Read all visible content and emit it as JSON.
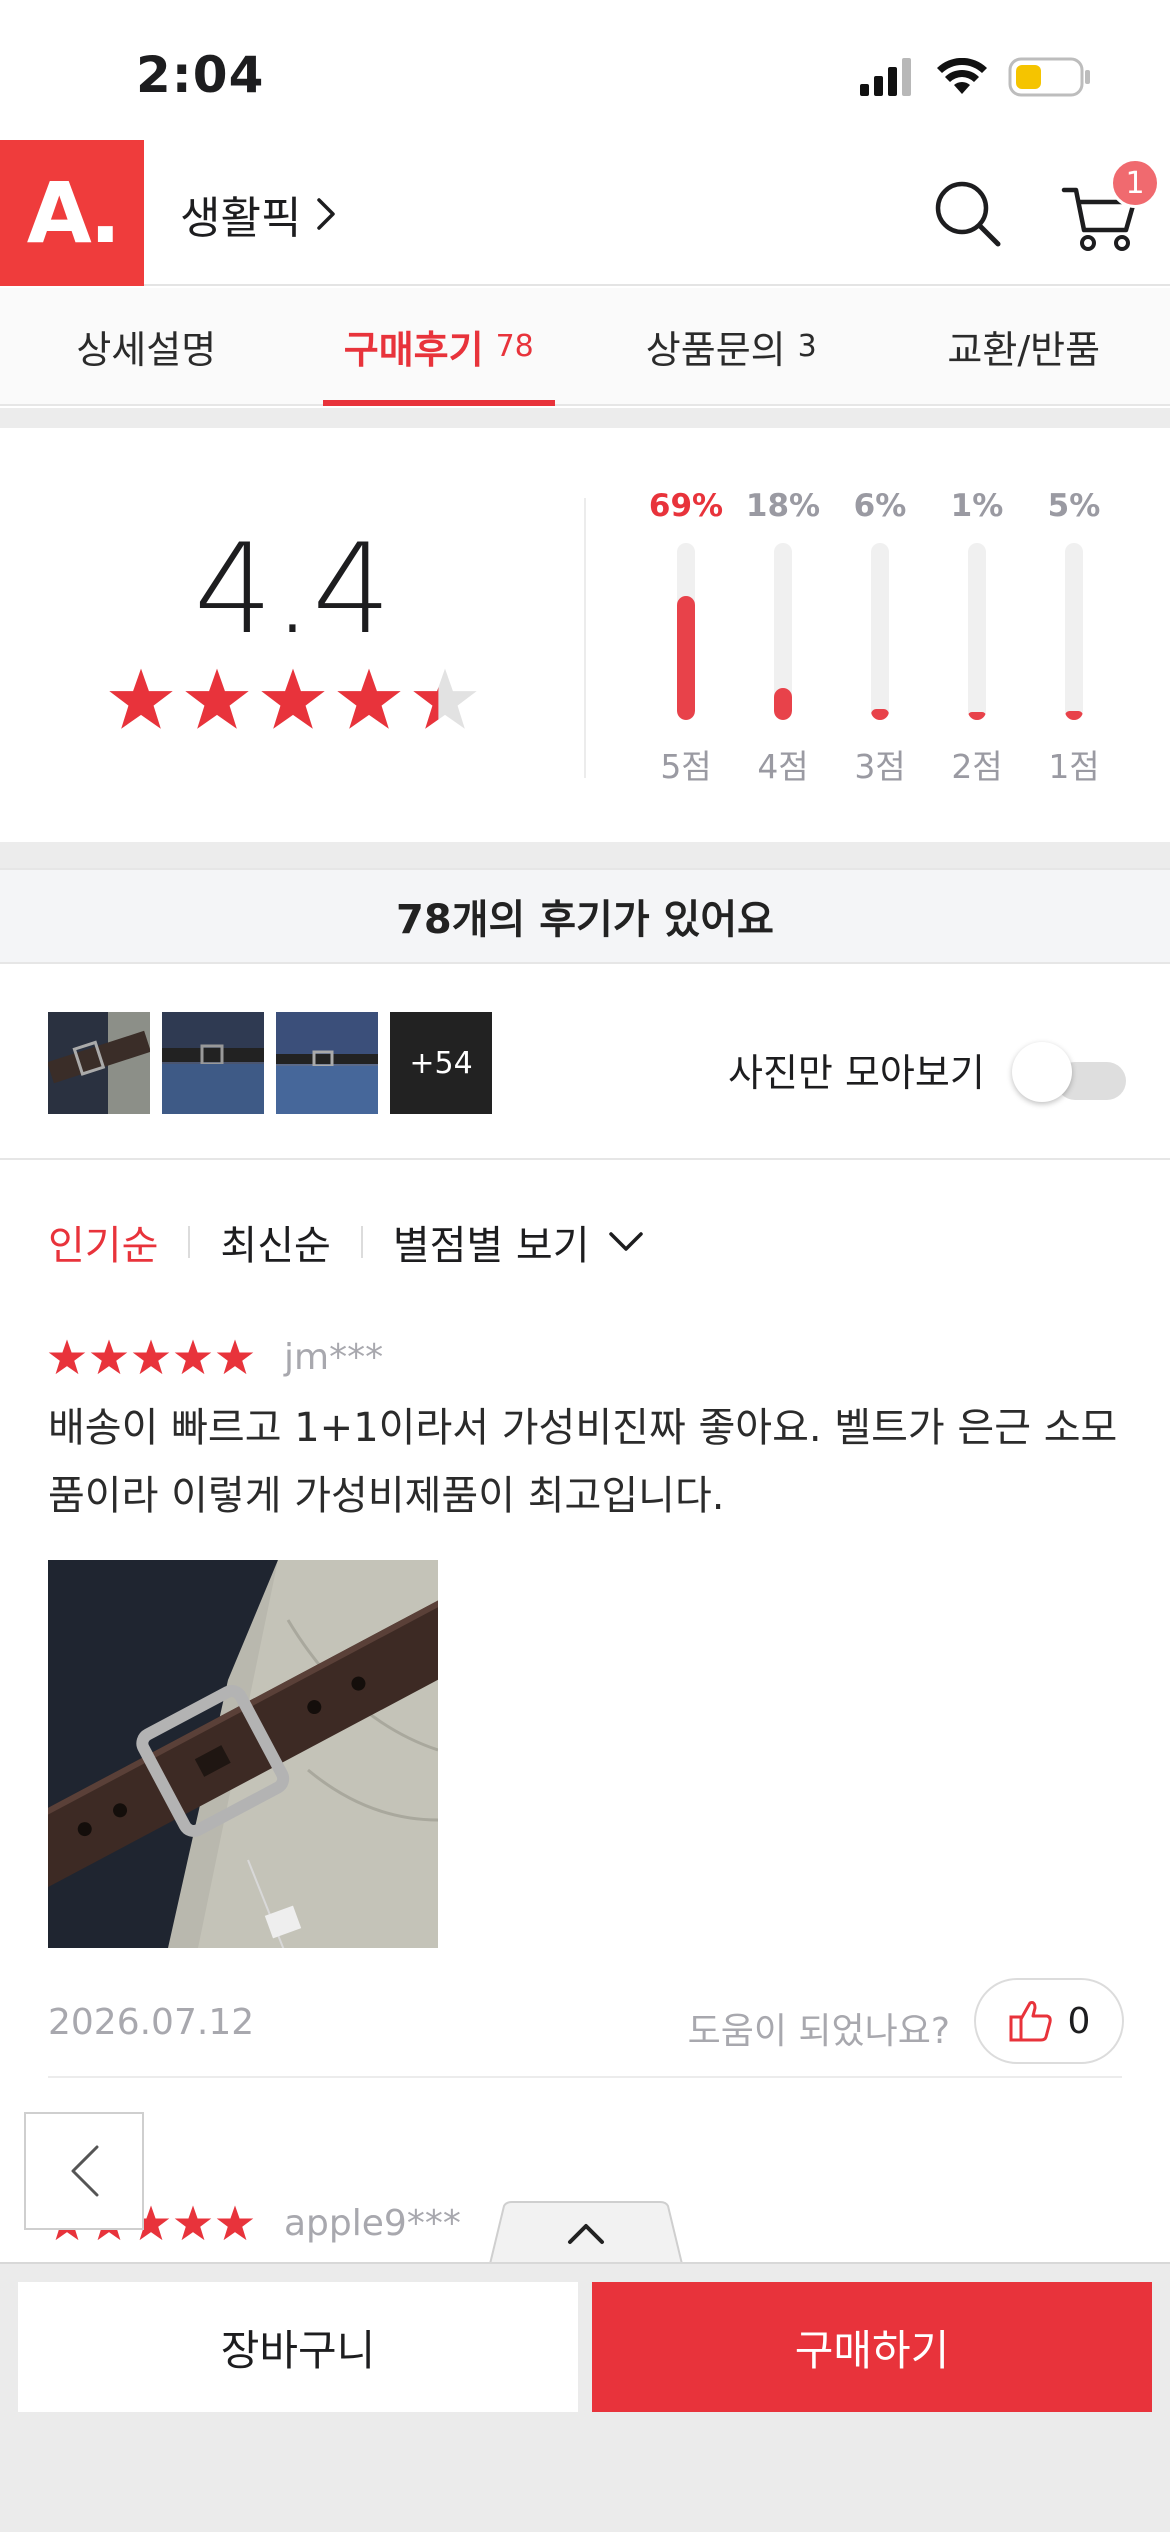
{
  "status_bar": {
    "time": "2:04"
  },
  "header": {
    "logo": "A.",
    "category": "생활픽",
    "cart_count": "1"
  },
  "tabs": [
    {
      "label": "상세설명",
      "count": ""
    },
    {
      "label": "구매후기",
      "count": "78",
      "active": true
    },
    {
      "label": "상품문의",
      "count": "3"
    },
    {
      "label": "교환/반품",
      "count": ""
    }
  ],
  "rating_summary": {
    "average": "4.4",
    "stars_value": 4.4,
    "distribution": [
      {
        "label": "5점",
        "percent_text": "69%",
        "value": 69
      },
      {
        "label": "4점",
        "percent_text": "18%",
        "value": 18
      },
      {
        "label": "3점",
        "percent_text": "6%",
        "value": 6
      },
      {
        "label": "2점",
        "percent_text": "1%",
        "value": 1
      },
      {
        "label": "1점",
        "percent_text": "5%",
        "value": 5
      }
    ]
  },
  "review_count_text": "78개의 후기가 있어요",
  "photos": {
    "more_label": "+54",
    "toggle_label": "사진만 모아보기",
    "toggle_on": false
  },
  "sort": {
    "popular": "인기순",
    "latest": "최신순",
    "by_rating": "별점별 보기"
  },
  "reviews": [
    {
      "rating": 5,
      "reviewer": "jm***",
      "text": "배송이 빠르고 1+1이라서 가성비진짜 좋아요. 벨트가 은근 소모품이라 이렇게 가성비제품이 최고입니다.",
      "date": "2026.07.12",
      "helpful_question": "도움이 되었나요?",
      "helpful_count": "0"
    },
    {
      "rating": 5,
      "reviewer": "apple9***"
    }
  ],
  "bottom_bar": {
    "cart_label": "장바구니",
    "buy_label": "구매하기"
  },
  "colors": {
    "accent": "#e8333b",
    "logo_bg": "#ef3c3c",
    "battery": "#f5c400"
  }
}
